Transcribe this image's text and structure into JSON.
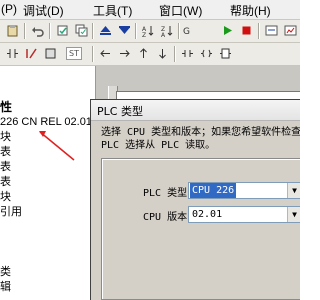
{
  "menubar": {
    "items": [
      "(P)",
      "调试(D)",
      "工具(T)",
      "窗口(W)",
      "帮助(H)"
    ]
  },
  "toolbar1": {
    "icons": [
      "paste-icon",
      "undo-icon",
      "compile-icon",
      "compile-all-icon",
      "upload-icon",
      "download-icon",
      "sort-asc-icon",
      "sort-desc-icon",
      "run-icon",
      "stop-icon"
    ]
  },
  "toolbar2": {
    "icons": [
      "program-status-icon",
      "ladder-contact-icon",
      "ladder-coil-icon",
      "ladder-box-icon",
      "line-left-icon",
      "line-right-icon",
      "line-up-icon",
      "line-down-icon",
      "contact-icon",
      "coil-icon",
      "box-icon"
    ],
    "badge": "ST"
  },
  "tree": {
    "items": [
      "性",
      "226 CN REL 02.01",
      "块",
      "表",
      "表",
      "表",
      "块",
      "引用",
      "",
      "",
      "",
      "",
      "类",
      "辑"
    ]
  },
  "dialog": {
    "title": "PLC 类型",
    "message": "选择 CPU 类型和版本；如果您希望软件检查 PLC 选择从 PLC 读取。",
    "plc_type_label": "PLC 类型",
    "plc_type_value": "CPU 226",
    "cpu_version_label": "CPU 版本",
    "cpu_version_value": "02.01"
  },
  "colors": {
    "selection": "#316ac5",
    "annotation": "#e02020",
    "run": "#1a9a1a",
    "stop": "#d01010",
    "nav_arrows": "#1a3fa0"
  }
}
